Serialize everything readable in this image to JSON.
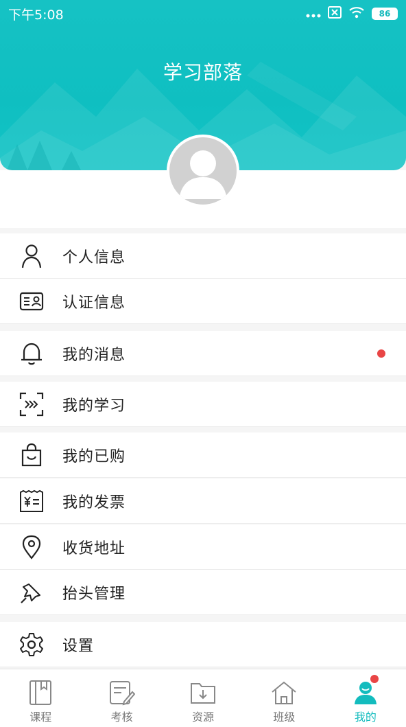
{
  "status_bar": {
    "time": "下午5:08",
    "battery": "86"
  },
  "header": {
    "title": "学习部落"
  },
  "menu": [
    {
      "label": "个人信息",
      "icon": "person-icon"
    },
    {
      "label": "认证信息",
      "icon": "id-card-icon"
    },
    {
      "label": "我的消息",
      "icon": "bell-icon",
      "has_badge": true
    },
    {
      "label": "我的学习",
      "icon": "study-icon"
    },
    {
      "label": "我的已购",
      "icon": "shopping-bag-icon"
    },
    {
      "label": "我的发票",
      "icon": "invoice-icon"
    },
    {
      "label": "收货地址",
      "icon": "location-pin-icon"
    },
    {
      "label": "抬头管理",
      "icon": "pushpin-icon"
    },
    {
      "label": "设置",
      "icon": "gear-icon"
    }
  ],
  "tabs": [
    {
      "label": "课程",
      "icon": "book-icon"
    },
    {
      "label": "考核",
      "icon": "exam-icon"
    },
    {
      "label": "资源",
      "icon": "download-folder-icon"
    },
    {
      "label": "班级",
      "icon": "house-icon"
    },
    {
      "label": "我的",
      "icon": "user-icon",
      "active": true,
      "has_badge": true
    }
  ],
  "colors": {
    "accent": "#13bcbe",
    "badge": "#e94545"
  }
}
